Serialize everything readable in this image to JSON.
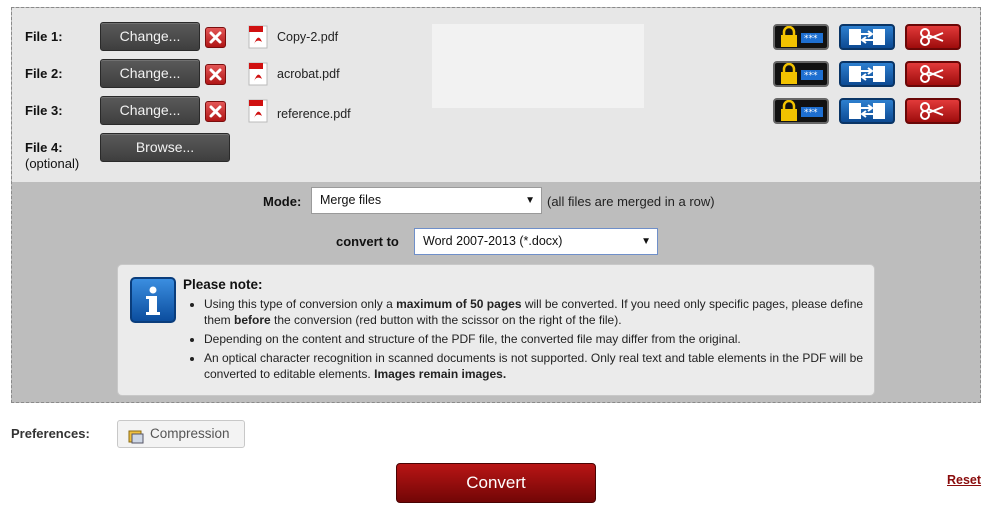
{
  "files": [
    {
      "label": "File 1:",
      "button": "Change...",
      "filename": "Copy-2.pdf",
      "optional": ""
    },
    {
      "label": "File 2:",
      "button": "Change...",
      "filename": "acrobat.pdf",
      "optional": ""
    },
    {
      "label": "File 3:",
      "button": "Change...",
      "filename": "reference.pdf",
      "optional": ""
    },
    {
      "label": "File 4:",
      "button": "Browse...",
      "filename": "",
      "optional": "(optional)"
    }
  ],
  "icons": {
    "remove": "close-icon",
    "file": "pdf-file-icon",
    "password": "password-lock-icon",
    "rotate": "page-order-icon",
    "cut": "scissors-icon",
    "info": "info-icon",
    "compression": "compression-icon"
  },
  "mode": {
    "label": "Mode:",
    "value": "Merge files",
    "hint": "(all files are merged in a row)"
  },
  "convert_to": {
    "label": "convert to",
    "value": "Word 2007-2013 (*.docx)"
  },
  "note": {
    "title": "Please note:",
    "items": [
      {
        "pre": "Using this type of conversion only a ",
        "bold1": "maximum of 50 pages",
        "mid": " will be converted. If you need only specific pages, please define them ",
        "bold2": "before",
        "post": " the conversion (red button with the scissor on the right of the file)."
      },
      {
        "text": "Depending on the content and structure of the PDF file, the converted file may differ from the original."
      },
      {
        "pre": "An optical character recognition in scanned documents is not supported. Only real text and table elements in the PDF will be converted to editable elements. ",
        "bold1": "Images remain images."
      }
    ]
  },
  "preferences": {
    "label": "Preferences:",
    "compression": "Compression"
  },
  "actions": {
    "convert": "Convert",
    "reset": "Reset"
  },
  "colors": {
    "accent_red": "#9e0c0c",
    "panel_bg": "#bdbdbd",
    "files_bg": "#e7e7e7",
    "info_blue": "#1a5fb4"
  }
}
